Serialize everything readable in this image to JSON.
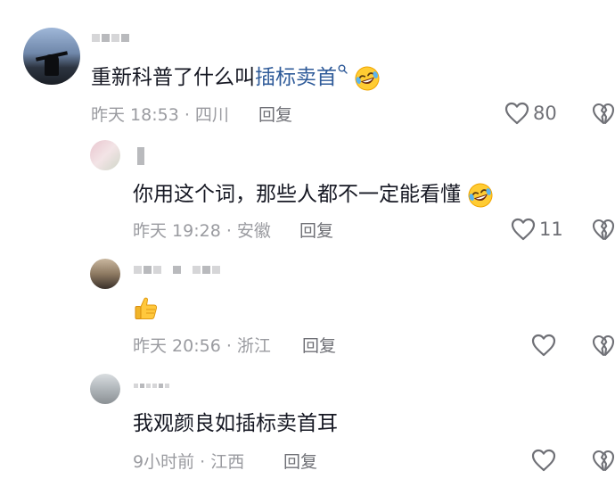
{
  "comments": [
    {
      "text_plain": "重新科普了什么叫",
      "text_highlight": "插标卖首",
      "search_glyph": "🔍",
      "emoji": "🤣",
      "time_location": "昨天 18:53 · 四川",
      "reply_label": "回复",
      "like_count": "80"
    },
    {
      "text": "你用这个词，那些人都不一定能看懂",
      "emoji": "🤣",
      "time_location": "昨天 19:28 · 安徽",
      "reply_label": "回复",
      "like_count": "11"
    },
    {
      "emoji": "👍",
      "time_location": "昨天 20:56 · 浙江",
      "reply_label": "回复",
      "like_count": ""
    },
    {
      "text": "我观颜良如插标卖首耳",
      "time_location": "9小时前 · 江西",
      "reply_label": "回复",
      "like_count": ""
    }
  ],
  "icons": {
    "like": "heart-outline-icon",
    "dislike": "broken-heart-icon"
  },
  "colors": {
    "text": "#161823",
    "meta": "#9a9ba0",
    "highlight": "#2f5b99",
    "icon": "#6f7076"
  }
}
